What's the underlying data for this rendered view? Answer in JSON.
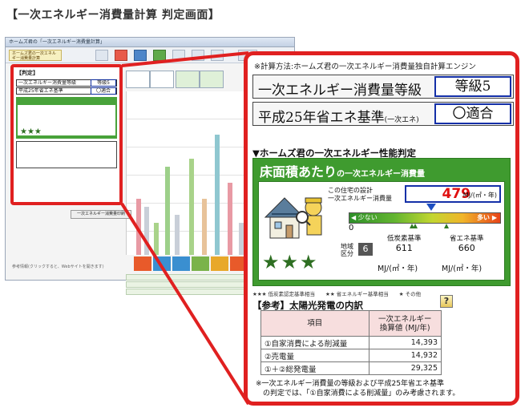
{
  "page_title": "【一次エネルギー消費量計算 判定画面】",
  "background_window": {
    "title": "ホームズ君の「一次エネルギー消費量計算」",
    "logo_text": "ホームズ君の一次エネルギー消費量計算",
    "footer_text": "参考情報(クリックすると、Webサイトを開きます)"
  },
  "mini_panel": {
    "heading": "【判定】",
    "row1": "一次エネルギー消費量等級",
    "row1_value": "等級5",
    "row2": "平成25年省エネ基準",
    "row2_value": "〇適合",
    "button": "一次エネルギー消費量印刷"
  },
  "panel": {
    "method_line": "※計算方法:ホームズ君の一次エネルギー消費量独自計算エンジン",
    "grade_label": "一次エネルギー消費量等級",
    "grade_value": "等級5",
    "standard_label": "平成25年省エネ基準",
    "standard_sub": "(一次エネ)",
    "standard_value": "〇適合",
    "perf_heading": "▼ホームズ君の一次エネルギー性能判定",
    "green_title": "床面積あたり",
    "green_title_sub": "の一次エネルギー消費量",
    "design_label_1": "この住宅の設計",
    "design_label_2": "一次エネルギー消費量",
    "energy_value": "479",
    "energy_unit": "MJ/(㎡・年)",
    "bar_left": "◀ 少ない",
    "bar_right": "多い ▶",
    "zero": "0",
    "region_label_1": "地域",
    "region_label_2": "区分",
    "region_value": "6",
    "low_carbon_label": "低炭素基準",
    "low_carbon_value": "611",
    "standard_std_label": "省エネ基準",
    "standard_std_value": "660",
    "unit_1": "MJ/(㎡・年)",
    "unit_2": "MJ/(㎡・年)",
    "stars": "★★★",
    "legend": "★★★ 低炭素認定基準相当　　★★ 省エネルギー基準相当　　★ その他",
    "ref_heading": "【参考】太陽光発電の内訳",
    "help_icon": "?",
    "table": {
      "header_item": "項目",
      "header_value_1": "一次エネルギー",
      "header_value_2": "換算値 (MJ/年)",
      "rows": [
        {
          "label": "①自家消費による削減量",
          "value": "14,393"
        },
        {
          "label": "②売電量",
          "value": "14,932"
        },
        {
          "label": "①＋②総発電量",
          "value": "29,325"
        }
      ]
    },
    "footnote_1": "※一次エネルギー消費量の等級および平成25年省エネ基準",
    "footnote_2": "　の判定では、「①自家消費による削減量」のみ考慮されます。"
  },
  "colors": {
    "highlight_red": "#e02020",
    "panel_green": "#3f9b2f",
    "value_blue": "#1430a8",
    "energy_red": "#e01010"
  }
}
